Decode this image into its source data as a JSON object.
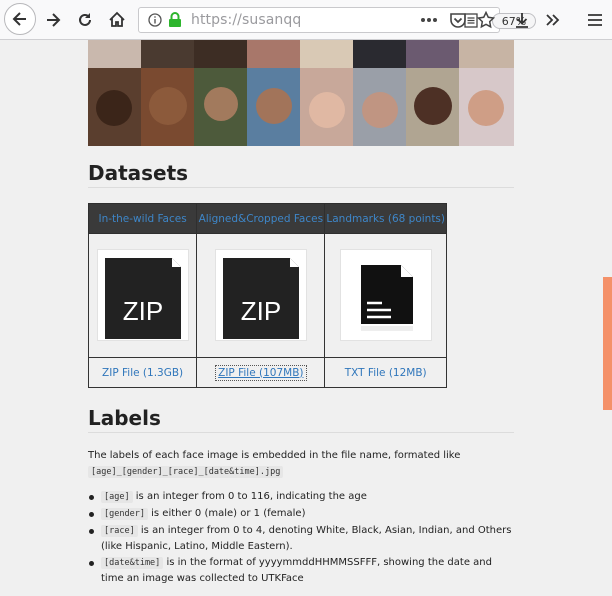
{
  "browser": {
    "url_text": "https://susanqq",
    "zoom": "67%",
    "icons": [
      "back-icon",
      "forward-icon",
      "reload-icon",
      "home-icon",
      "info-icon",
      "lock-icon",
      "reader-view-icon",
      "more-icon",
      "pocket-icon",
      "bookmark-star-icon",
      "download-icon",
      "overflow-icon",
      "menu-icon"
    ]
  },
  "datasets": {
    "heading": "Datasets",
    "columns": [
      "In-the-wild Faces",
      "Aligned&Cropped Faces",
      "Landmarks (68 points)"
    ],
    "icons": [
      {
        "type": "zip",
        "label": "ZIP"
      },
      {
        "type": "zip",
        "label": "ZIP"
      },
      {
        "type": "txt",
        "label": ""
      }
    ],
    "links": [
      "ZIP File (1.3GB)",
      "ZIP File (107MB)",
      "TXT File (12MB)"
    ],
    "selected_link_index": 1
  },
  "labels": {
    "heading": "Labels",
    "intro": "The labels of each face image is embedded in the file name, formated like",
    "format_code": "[age]_[gender]_[race]_[date&time].jpg",
    "items": [
      {
        "code": "[age]",
        "text": " is an integer from 0 to 116, indicating the age"
      },
      {
        "code": "[gender]",
        "text": " is either 0 (male) or 1 (female)"
      },
      {
        "code": "[race]",
        "text": " is an integer from 0 to 4, denoting White, Black, Asian, Indian, and Others (like Hispanic, Latino, Middle Eastern)."
      },
      {
        "code": "[date&time]",
        "text": " is in the format of yyyymmddHHMMSSFFF, showing the date and time an image was collected to UTKFace"
      }
    ]
  },
  "colors": {
    "accent_link": "#2f76bb",
    "table_header": "#3a3a3a",
    "scroll_thumb": "#f49169"
  }
}
